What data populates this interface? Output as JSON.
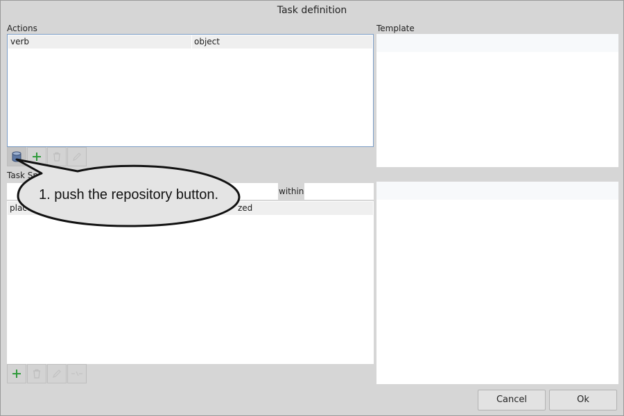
{
  "window": {
    "title": "Task definition"
  },
  "actions": {
    "label": "Actions",
    "columns": [
      "verb",
      "object"
    ]
  },
  "template": {
    "label": "Template"
  },
  "task_section": {
    "label_visible": "Task Sp",
    "within_label": "within",
    "columns_visible": [
      "place",
      "zed"
    ]
  },
  "buttons": {
    "cancel": "Cancel",
    "ok": "Ok"
  },
  "callout": {
    "text": "1. push the repository button."
  },
  "icons": {
    "repository": "database-icon",
    "add": "plus-icon",
    "delete": "trash-icon",
    "edit": "edit-icon",
    "link": "link-icon"
  },
  "colors": {
    "add_green": "#2e9a3a",
    "focus_border": "#7a9cc6",
    "callout_fill": "#e4e4e4"
  }
}
